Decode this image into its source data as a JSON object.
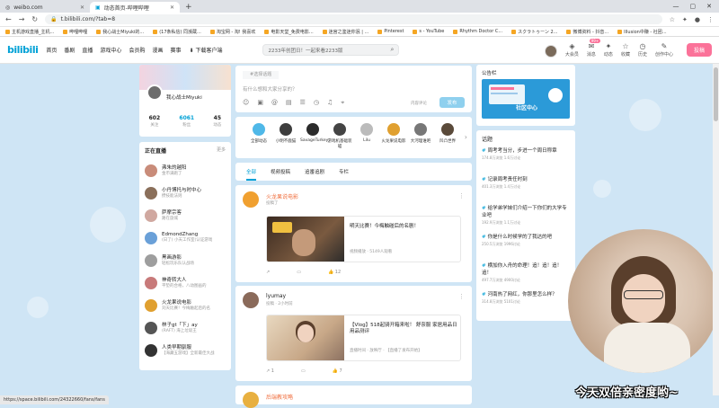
{
  "browser": {
    "tabs": [
      {
        "label": "weibo.com"
      },
      {
        "label": "动态首页-哔哩哔哩"
      }
    ],
    "url": "t.bilibili.com/?tab=8",
    "bookmarks": [
      "主机游戏直播_主机...",
      "哔哩哔哩",
      "我心战士Miyuki的...",
      "(17条私信) 同濒蔵...",
      "淘宝网 - 淘! 我喜欢",
      "电影天堂_免费电影...",
      "迷宫之鉴迷你泯 | ...",
      "Pinterest",
      "s - YouTube",
      "Rhythm Doctor C...",
      "スクラトゥーン 2...",
      "微博资料 - 抖音...",
      "Illusion中赚 - 社团..."
    ]
  },
  "header": {
    "logo": "bilibili",
    "nav": [
      "首页",
      "番剧",
      "直播",
      "游戏中心",
      "会员购",
      "漫画",
      "赛事"
    ],
    "download": "下载客户端",
    "search_placeholder": "2233年创团日！一起来看2233版",
    "icons": [
      {
        "label": "大会员",
        "icon": "vip-icon"
      },
      {
        "label": "消息",
        "icon": "message-icon",
        "badge": "99+"
      },
      {
        "label": "动态",
        "icon": "dynamic-icon"
      },
      {
        "label": "收藏",
        "icon": "star-icon"
      },
      {
        "label": "历史",
        "icon": "history-icon"
      },
      {
        "label": "创作中心",
        "icon": "bulb-icon"
      }
    ],
    "upload": "投稿"
  },
  "profile": {
    "name": "我心战士Miyuki",
    "stats": [
      {
        "value": "602",
        "label": "关注"
      },
      {
        "value": "6061",
        "label": "粉丝"
      },
      {
        "value": "45",
        "label": "动态"
      }
    ]
  },
  "live": {
    "title": "正在直播",
    "more": "更多",
    "items": [
      {
        "name": "弗朱的越阳",
        "title": "金币满跑了",
        "color": "#c98c7a"
      },
      {
        "name": "小丹博托与时中心",
        "title": "攒技能法则",
        "color": "#8a6f5a"
      },
      {
        "name": "萨摩宗客",
        "title": "路在旋城",
        "color": "#d0a8a0"
      },
      {
        "name": "EdmondZhang",
        "title": "(日了) 小天工作室(认证游戏",
        "color": "#6aa0d8"
      },
      {
        "name": "黑画游影",
        "title": "轻松玩乐队认战场",
        "color": "#9e9e9e"
      },
      {
        "name": "神奇转大人",
        "title": "平垫的合格，八动图画的",
        "color": "#c87a7a"
      },
      {
        "name": "火龙果说电影",
        "title": "刘天比赛！今梅触起后的名",
        "color": "#e0a030"
      },
      {
        "name": "林子gt「下」ay",
        "title": "(RAFT) 海上垃圾王",
        "color": "#555"
      },
      {
        "name": "人类早期驯服",
        "title": "【海藏五游戏】全新最佳大战",
        "color": "#333"
      }
    ]
  },
  "composer": {
    "topic_label": "#选择话题",
    "placeholder": "有什么想和大家分享的？",
    "permission": "内容评论",
    "send": "发布"
  },
  "ups": [
    {
      "name": "全部动态",
      "color": "#4fb8e8"
    },
    {
      "name": "小明不鹿猫",
      "color": "#3d3d3d"
    },
    {
      "name": "SavageTurkey",
      "color": "#2b2b2b"
    },
    {
      "name": "游戏机基础装喵",
      "color": "#444"
    },
    {
      "name": "Lilu",
      "color": "#bbb"
    },
    {
      "name": "火龙果说电影",
      "color": "#e0a030"
    },
    {
      "name": "大河理谁吧",
      "color": "#777"
    },
    {
      "name": "凹凸世界",
      "color": "#5a4a3a"
    }
  ],
  "feed_tabs": [
    "全部",
    "视频投稿",
    "追番追剧",
    "专栏"
  ],
  "posts": [
    {
      "name": "火龙果说电影",
      "date": "投稿了",
      "text": "",
      "video_title": "明天比赛！今梅触碰后的名剧！",
      "video_meta": "视频播放 · 5149人观看",
      "likes": "",
      "comments": "",
      "shares": "12",
      "name_color": "#f07040"
    },
    {
      "name": "lyumay",
      "date": "投稿 · 2小时前",
      "text": "",
      "video_title": "【Vlog】518起骑开箱来啦！ 舒奈服 家居用品日用品测评",
      "video_meta": "直播时间 · 放映厅 · 【直播了发布开始】",
      "likes": "1",
      "comments": "",
      "shares": "7",
      "name_color": "#222"
    },
    {
      "name": "后端教攻略",
      "date": "",
      "text": "",
      "video_title": "",
      "video_meta": "",
      "likes": "",
      "comments": "",
      "shares": "",
      "name_color": "#222"
    }
  ],
  "notice": {
    "title": "公告栏",
    "banner_text": "社区中心"
  },
  "topics": {
    "title": "话题",
    "items": [
      {
        "name": "周考考当分，步进一个周日称章",
        "meta": "174.8万浏览 1.6万讨论"
      },
      {
        "name": "记录周考责任时刻",
        "meta": "401.3万浏览 1.4万讨论"
      },
      {
        "name": "给学弟学妹们介绍一下你们的大学专业吧",
        "meta": "192.9万浏览 1.1万讨论"
      },
      {
        "name": "你是什么时候学的了我达的吧",
        "meta": "250.5万浏览 1996讨论"
      },
      {
        "name": "横加你入舟的命理！追！追！追！追！",
        "meta": "497.7万浏览 4900讨论"
      },
      {
        "name": "河南热了网红，你那里怎么样？",
        "meta": "314.8万浏览 5101讨论"
      }
    ]
  },
  "stream": {
    "caption": "今天双倍亲密度哟~"
  },
  "status_url": "https://space.bilibili.com/24322660/fans/fans"
}
